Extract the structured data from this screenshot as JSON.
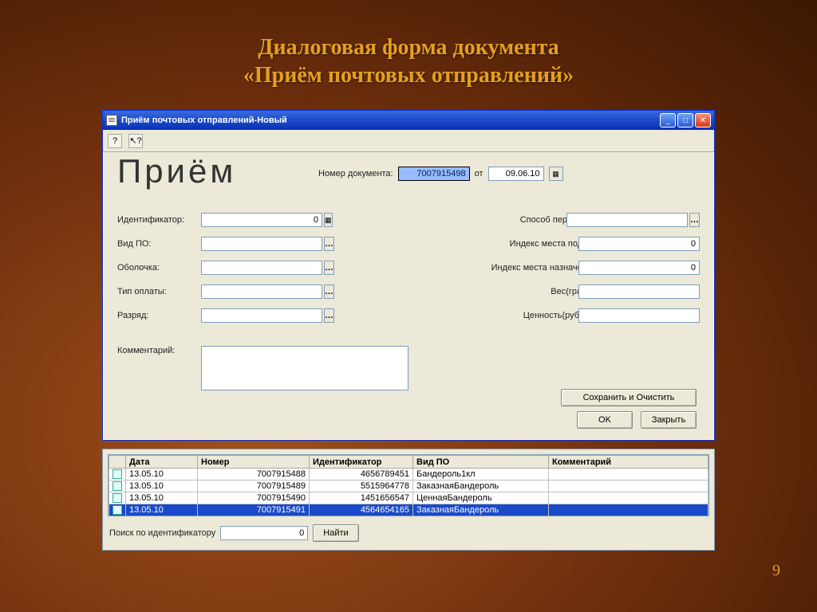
{
  "slide": {
    "title_line1": "Диалоговая форма документа",
    "title_line2": "«Приём почтовых отправлений»",
    "page_number": "9"
  },
  "window": {
    "title": "Приём почтовых отправлений-Новый",
    "hero": "Приём",
    "top": {
      "doc_no_label": "Номер документа:",
      "doc_no_value": "7007915498",
      "from_label": "от",
      "date_value": "09.06.10"
    },
    "fields": {
      "identifier_label": "Идентификатор:",
      "identifier_value": "0",
      "po_type_label": "Вид ПО:",
      "po_type_value": "",
      "shell_label": "Оболочка:",
      "shell_value": "",
      "pay_type_label": "Тип оплаты:",
      "pay_type_value": "",
      "rank_label": "Разряд:",
      "rank_value": "",
      "send_method_label": "Способ пересылки:",
      "send_method_value": "",
      "in_index_label": "Индекс места подачи:",
      "in_index_value": "0",
      "dest_index_label": "Индекс места назначения:",
      "dest_index_value": "0",
      "weight_label": "Вес(грамм):",
      "weight_value": "",
      "value_label": "Ценность(рублей):",
      "value_value": "",
      "comment_label": "Комментарий:",
      "comment_value": ""
    },
    "buttons": {
      "save_clear": "Сохранить и Очистить",
      "ok": "OK",
      "close": "Закрыть"
    }
  },
  "tableWindow": {
    "columns": [
      "Дата",
      "Номер",
      "Идентификатор",
      "Вид ПО",
      "Комментарий"
    ],
    "rows": [
      {
        "date": "13.05.10",
        "number": "7007915488",
        "id": "4656789451",
        "po": "Бандероль1кл",
        "comment": ""
      },
      {
        "date": "13.05.10",
        "number": "7007915489",
        "id": "5515964778",
        "po": "ЗаказнаяБандероль",
        "comment": ""
      },
      {
        "date": "13.05.10",
        "number": "7007915490",
        "id": "1451656547",
        "po": "ЦеннаяБандероль",
        "comment": ""
      },
      {
        "date": "13.05.10",
        "number": "7007915491",
        "id": "4564654165",
        "po": "ЗаказнаяБандероль",
        "comment": ""
      }
    ],
    "selected_index": 3,
    "search_label": "Поиск по идентификатору",
    "search_value": "0",
    "find_button": "Найти"
  }
}
